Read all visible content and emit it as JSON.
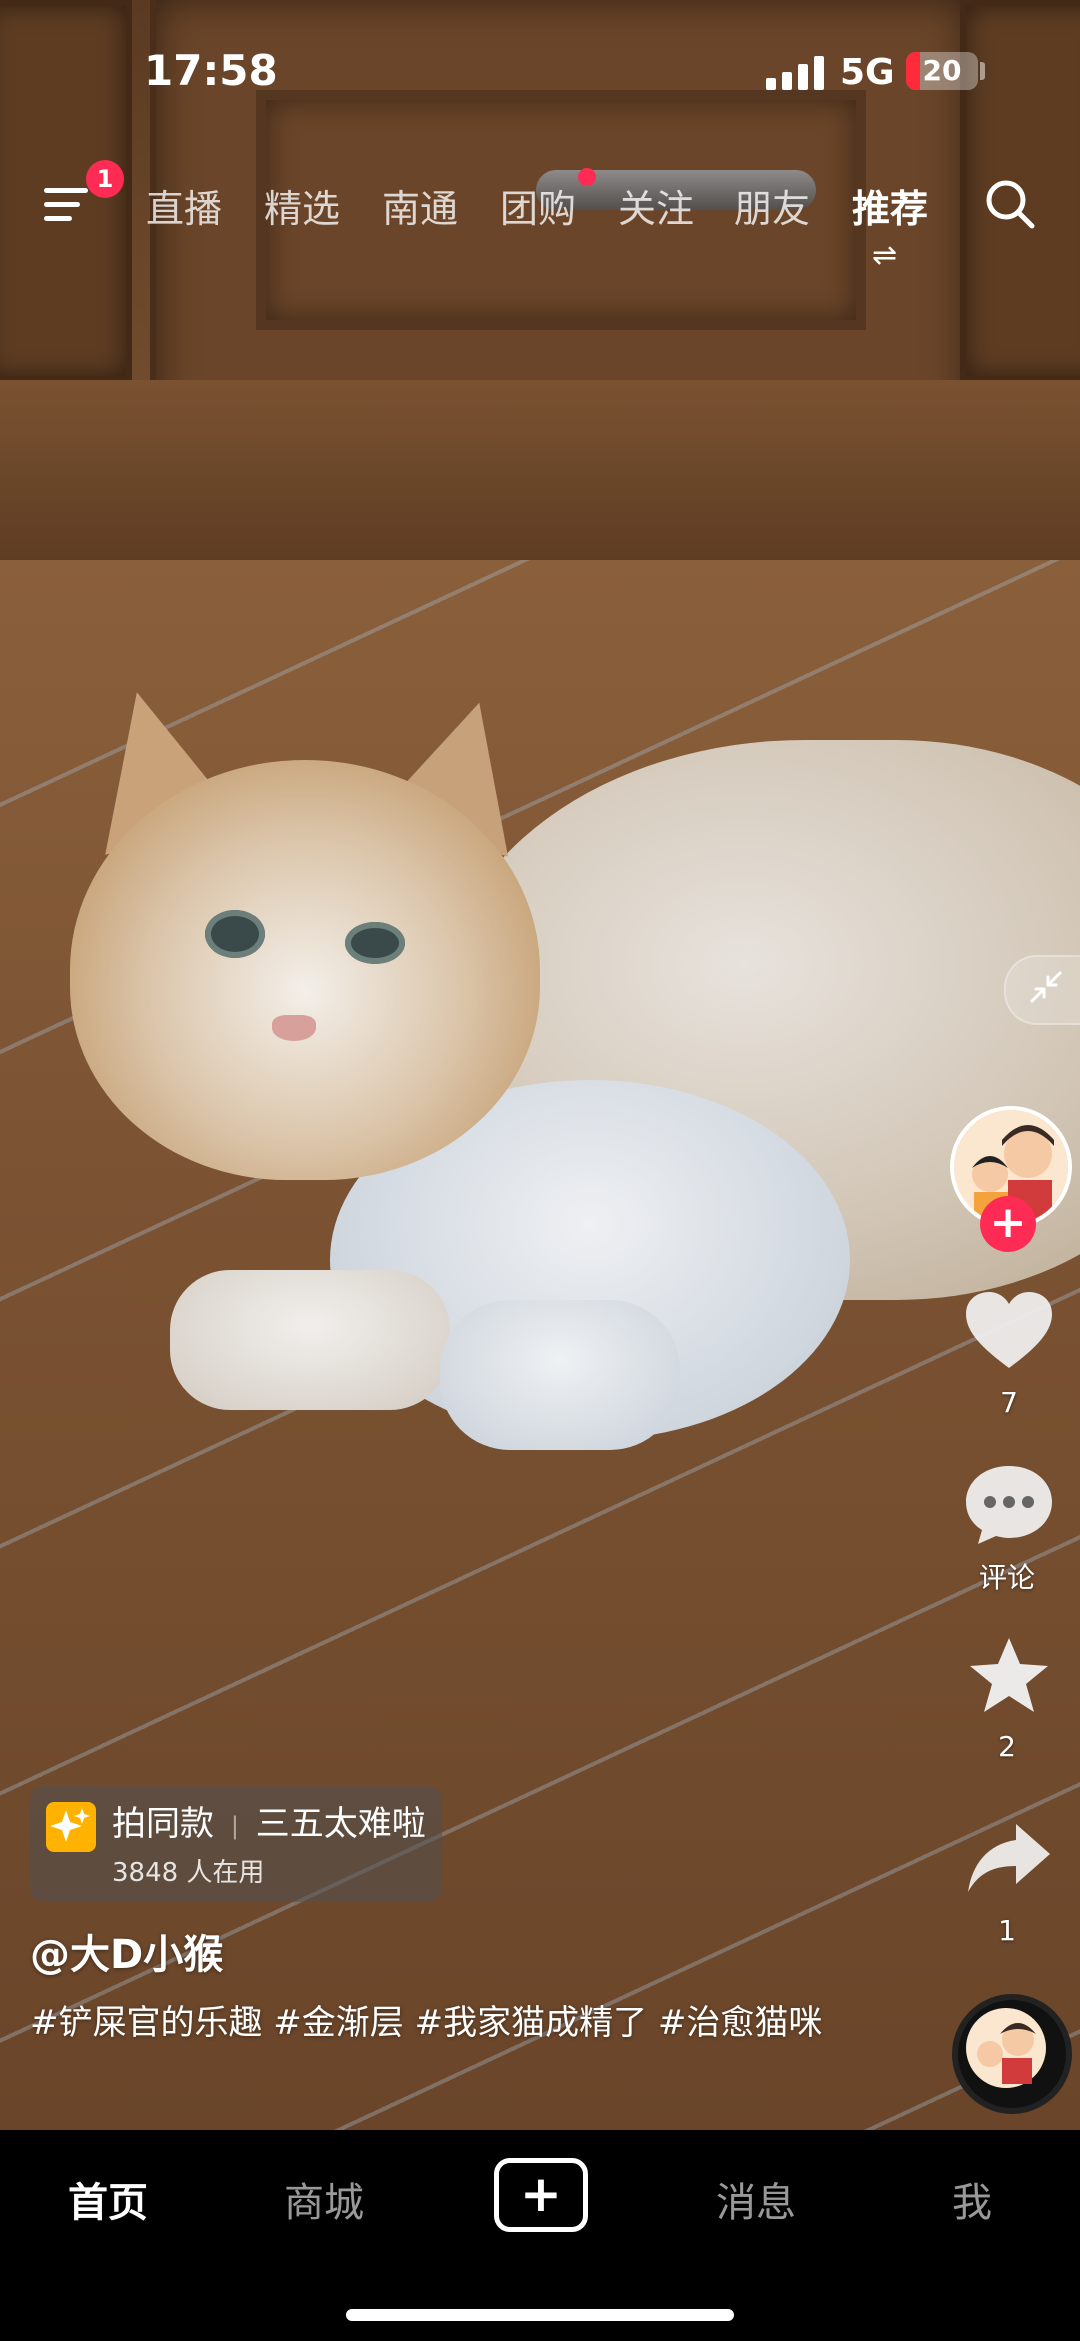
{
  "status_bar": {
    "time": "17:58",
    "network": "5G",
    "battery": "20"
  },
  "top_nav": {
    "menu_badge": "1",
    "tabs": [
      {
        "label": "直播"
      },
      {
        "label": "精选"
      },
      {
        "label": "南通"
      },
      {
        "label": "团购"
      },
      {
        "label": "关注"
      },
      {
        "label": "朋友"
      },
      {
        "label": "推荐"
      }
    ],
    "active_tab": "推荐",
    "active_tab_glyph": "⇌"
  },
  "right_rail": {
    "like_count": "7",
    "comment_label": "评论",
    "favorite_count": "2",
    "share_count": "1",
    "follow_glyph": "+"
  },
  "caption": {
    "template_label": "拍同款",
    "template_separator": "|",
    "template_name": "三五太难啦",
    "template_users": "3848 人在用",
    "author": "@大D小猴",
    "description": "#铲屎官的乐趣 #金渐层 #我家猫成精了 #治愈猫咪"
  },
  "bottom_tabs": [
    {
      "label": "首页"
    },
    {
      "label": "商城"
    },
    {
      "label": "+"
    },
    {
      "label": "消息"
    },
    {
      "label": "我"
    }
  ],
  "colors": {
    "accent": "#fe2c55",
    "spark": "#ffb300"
  }
}
